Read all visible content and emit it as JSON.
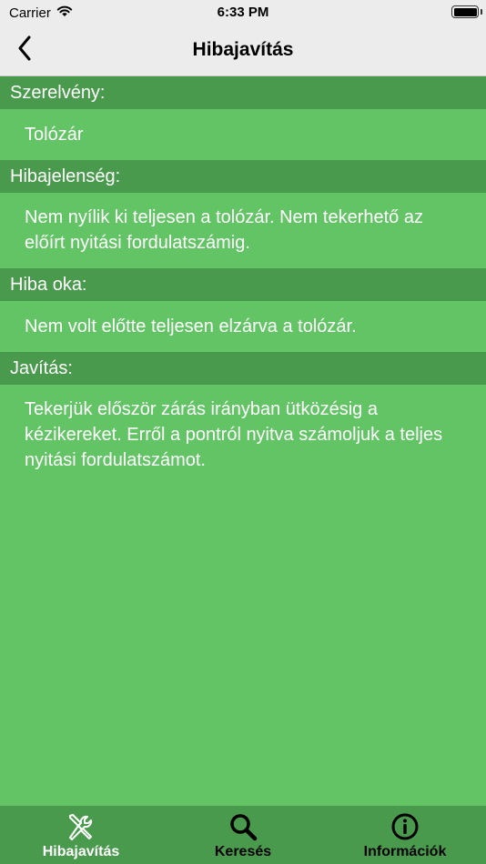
{
  "status": {
    "carrier": "Carrier",
    "time": "6:33 PM"
  },
  "nav": {
    "title": "Hibajavítás",
    "back_icon": "chevron-left-icon"
  },
  "sections": [
    {
      "header": "Szerelvény:",
      "body": "Tolózár"
    },
    {
      "header": "Hibajelenség:",
      "body": "Nem nyílik ki teljesen a tolózár. Nem tekerhető az előírt nyitási fordulatszámig."
    },
    {
      "header": "Hiba oka:",
      "body": "Nem volt előtte teljesen elzárva a tolózár."
    },
    {
      "header": "Javítás:",
      "body": "Tekerjük először zárás irányban ütközésig a kézikereket. Erről a pontról nyitva számoljuk a teljes nyitási fordulatszámot."
    }
  ],
  "tabs": [
    {
      "label": "Hibajavítás",
      "icon": "tools-icon",
      "active": true
    },
    {
      "label": "Keresés",
      "icon": "search-icon",
      "active": false
    },
    {
      "label": "Információk",
      "icon": "info-icon",
      "active": false
    }
  ],
  "colors": {
    "background": "#63c466",
    "header": "#4a9a4d",
    "bar": "#ececec"
  }
}
